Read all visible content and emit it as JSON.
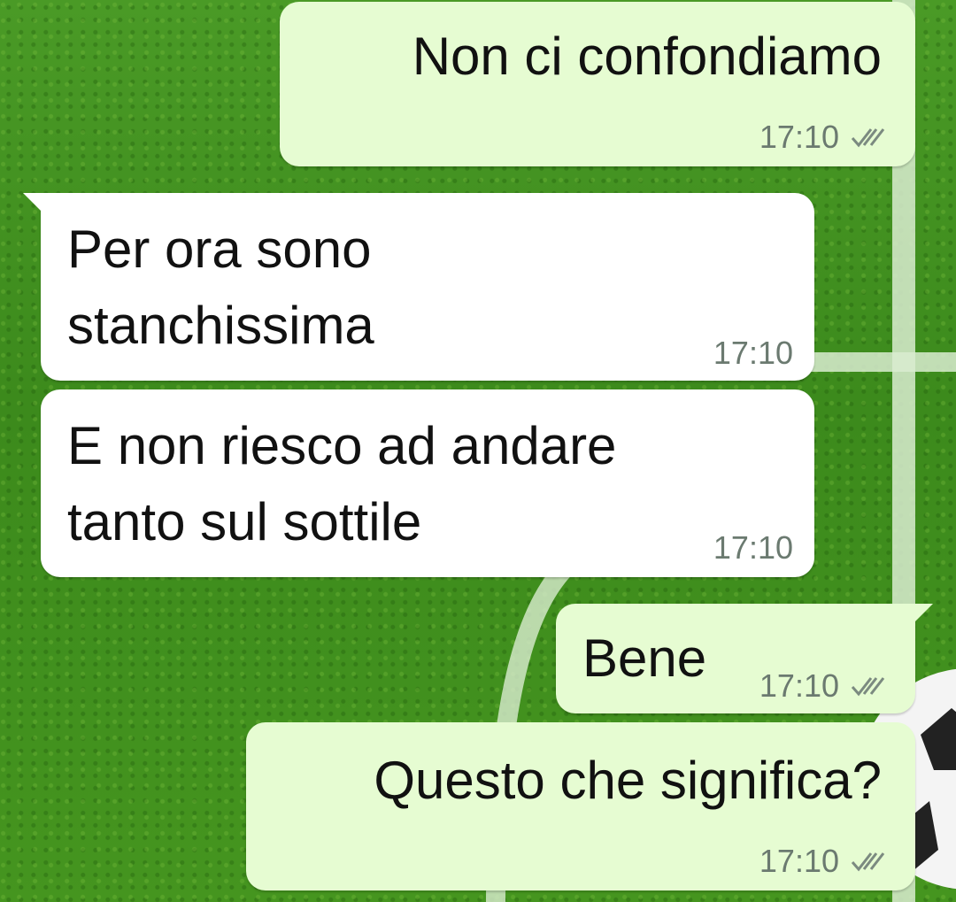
{
  "chat": {
    "messages": [
      {
        "direction": "outgoing",
        "lines": [
          "Non ci confondiamo"
        ],
        "time": "17:10",
        "status_icon": "double-check-icon"
      },
      {
        "direction": "incoming",
        "lines": [
          "Per ora sono",
          "stanchissima"
        ],
        "time": "17:10"
      },
      {
        "direction": "incoming",
        "lines": [
          "E non riesco ad andare",
          "tanto sul sottile"
        ],
        "time": "17:10"
      },
      {
        "direction": "outgoing",
        "lines": [
          "Bene"
        ],
        "time": "17:10",
        "status_icon": "double-check-icon"
      },
      {
        "direction": "outgoing",
        "lines": [
          "Questo che significa?"
        ],
        "time": "17:10",
        "status_icon": "double-check-icon"
      }
    ]
  },
  "theme": {
    "outgoing_bubble": "#e6fcd2",
    "incoming_bubble": "#ffffff",
    "wallpaper": "football-pitch",
    "timestamp_color": "#6b7a70"
  }
}
